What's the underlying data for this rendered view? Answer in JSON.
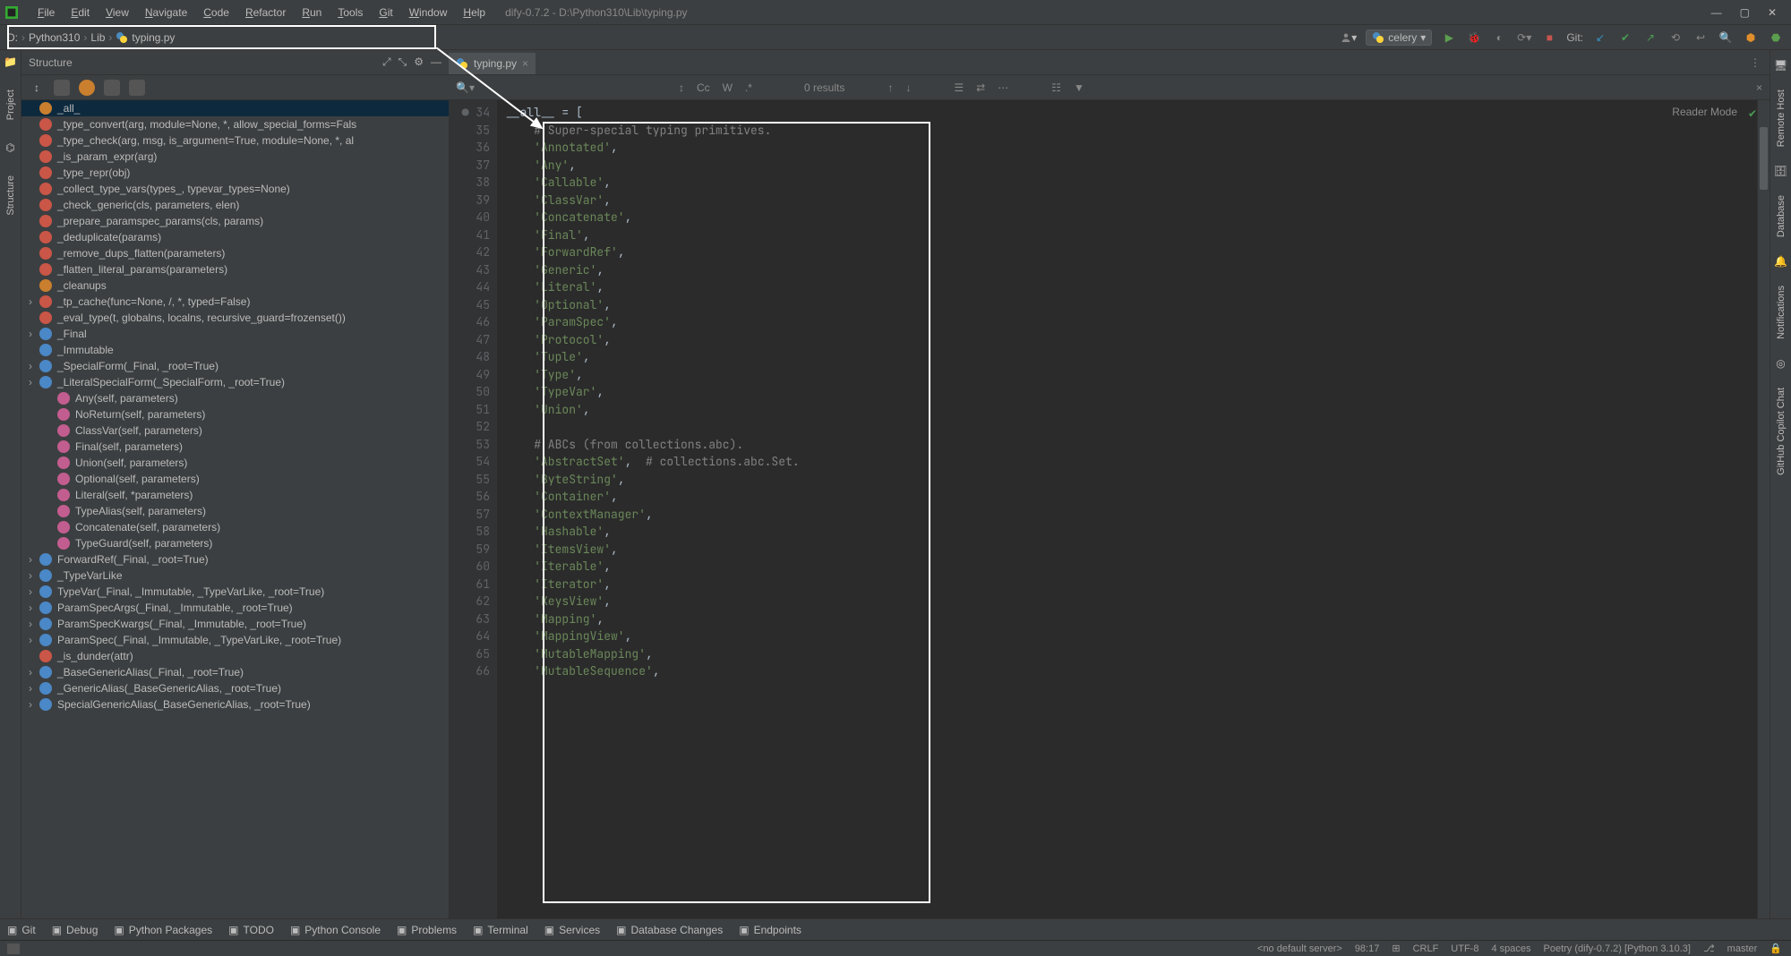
{
  "window": {
    "title": "dify-0.7.2 - D:\\Python310\\Lib\\typing.py"
  },
  "menu": [
    "File",
    "Edit",
    "View",
    "Navigate",
    "Code",
    "Refactor",
    "Run",
    "Tools",
    "Git",
    "Window",
    "Help"
  ],
  "breadcrumb": {
    "drive": "D:",
    "p1": "Python310",
    "p2": "Lib",
    "p3": "typing.py"
  },
  "runconfig": {
    "name": "celery"
  },
  "git_label": "Git:",
  "tab": {
    "name": "typing.py"
  },
  "find": {
    "results": "0 results",
    "cc": "Cc",
    "w": "W",
    "star": ".*"
  },
  "reader_mode": "Reader Mode",
  "sidebar": {
    "title": "Structure"
  },
  "rails": {
    "project": "Project",
    "structure": "Structure",
    "remote": "Remote Host",
    "database": "Database",
    "notifications": "Notifications",
    "copilot": "GitHub Copilot Chat"
  },
  "tree": [
    {
      "ic": "v",
      "chev": "",
      "t": "_all_",
      "sel": true
    },
    {
      "ic": "f",
      "t": "_type_convert(arg, module=None, *, allow_special_forms=Fals"
    },
    {
      "ic": "f",
      "t": "_type_check(arg, msg, is_argument=True, module=None, *, al"
    },
    {
      "ic": "f",
      "t": "_is_param_expr(arg)"
    },
    {
      "ic": "f",
      "t": "_type_repr(obj)"
    },
    {
      "ic": "f",
      "t": "_collect_type_vars(types_, typevar_types=None)"
    },
    {
      "ic": "f",
      "t": "_check_generic(cls, parameters, elen)"
    },
    {
      "ic": "f",
      "t": "_prepare_paramspec_params(cls, params)"
    },
    {
      "ic": "f",
      "t": "_deduplicate(params)"
    },
    {
      "ic": "f",
      "t": "_remove_dups_flatten(parameters)"
    },
    {
      "ic": "f",
      "t": "_flatten_literal_params(parameters)"
    },
    {
      "ic": "v",
      "t": "_cleanups"
    },
    {
      "ic": "f",
      "chev": "›",
      "t": "_tp_cache(func=None, /, *, typed=False)"
    },
    {
      "ic": "f",
      "t": "_eval_type(t, globalns, localns, recursive_guard=frozenset())"
    },
    {
      "ic": "c",
      "chev": "›",
      "t": "_Final"
    },
    {
      "ic": "c",
      "t": "_Immutable"
    },
    {
      "ic": "c",
      "chev": "›",
      "t": "_SpecialForm(_Final, _root=True)"
    },
    {
      "ic": "c",
      "chev": "›",
      "t": "_LiteralSpecialForm(_SpecialForm, _root=True)"
    },
    {
      "ic": "m",
      "indent": true,
      "t": "Any(self, parameters)"
    },
    {
      "ic": "m",
      "indent": true,
      "t": "NoReturn(self, parameters)"
    },
    {
      "ic": "m",
      "indent": true,
      "t": "ClassVar(self, parameters)"
    },
    {
      "ic": "m",
      "indent": true,
      "t": "Final(self, parameters)"
    },
    {
      "ic": "m",
      "indent": true,
      "t": "Union(self, parameters)"
    },
    {
      "ic": "m",
      "indent": true,
      "t": "Optional(self, parameters)"
    },
    {
      "ic": "m",
      "indent": true,
      "t": "Literal(self, *parameters)"
    },
    {
      "ic": "m",
      "indent": true,
      "t": "TypeAlias(self, parameters)"
    },
    {
      "ic": "m",
      "indent": true,
      "t": "Concatenate(self, parameters)"
    },
    {
      "ic": "m",
      "indent": true,
      "t": "TypeGuard(self, parameters)"
    },
    {
      "ic": "c",
      "chev": "›",
      "t": "ForwardRef(_Final, _root=True)"
    },
    {
      "ic": "c",
      "chev": "›",
      "t": "_TypeVarLike"
    },
    {
      "ic": "c",
      "chev": "›",
      "t": "TypeVar(_Final, _Immutable, _TypeVarLike, _root=True)"
    },
    {
      "ic": "c",
      "chev": "›",
      "t": "ParamSpecArgs(_Final, _Immutable, _root=True)"
    },
    {
      "ic": "c",
      "chev": "›",
      "t": "ParamSpecKwargs(_Final, _Immutable, _root=True)"
    },
    {
      "ic": "c",
      "chev": "›",
      "t": "ParamSpec(_Final, _Immutable, _TypeVarLike, _root=True)"
    },
    {
      "ic": "f",
      "t": "_is_dunder(attr)"
    },
    {
      "ic": "c",
      "chev": "›",
      "t": "_BaseGenericAlias(_Final, _root=True)"
    },
    {
      "ic": "c",
      "chev": "›",
      "t": "_GenericAlias(_BaseGenericAlias, _root=True)"
    },
    {
      "ic": "c",
      "chev": "›",
      "t": "SpecialGenericAlias(_BaseGenericAlias, _root=True)"
    }
  ],
  "lines": [
    {
      "n": 34,
      "html": "__all__ = ["
    },
    {
      "n": 35,
      "html": "    <span class='cm'># Super-special typing primitives.</span>"
    },
    {
      "n": 36,
      "html": "    <span class='s'>'Annotated'</span>,"
    },
    {
      "n": 37,
      "html": "    <span class='s'>'Any'</span>,"
    },
    {
      "n": 38,
      "html": "    <span class='s'>'Callable'</span>,"
    },
    {
      "n": 39,
      "html": "    <span class='s'>'ClassVar'</span>,"
    },
    {
      "n": 40,
      "html": "    <span class='s'>'Concatenate'</span>,"
    },
    {
      "n": 41,
      "html": "    <span class='s'>'Final'</span>,"
    },
    {
      "n": 42,
      "html": "    <span class='s'>'ForwardRef'</span>,"
    },
    {
      "n": 43,
      "html": "    <span class='s'>'Generic'</span>,"
    },
    {
      "n": 44,
      "html": "    <span class='s'>'Literal'</span>,"
    },
    {
      "n": 45,
      "html": "    <span class='s'>'Optional'</span>,"
    },
    {
      "n": 46,
      "html": "    <span class='s'>'ParamSpec'</span>,"
    },
    {
      "n": 47,
      "html": "    <span class='s'>'Protocol'</span>,"
    },
    {
      "n": 48,
      "html": "    <span class='s'>'Tuple'</span>,"
    },
    {
      "n": 49,
      "html": "    <span class='s'>'Type'</span>,"
    },
    {
      "n": 50,
      "html": "    <span class='s'>'TypeVar'</span>,"
    },
    {
      "n": 51,
      "html": "    <span class='s'>'Union'</span>,"
    },
    {
      "n": 52,
      "html": ""
    },
    {
      "n": 53,
      "html": "    <span class='cm'># ABCs (from collections.abc).</span>"
    },
    {
      "n": 54,
      "html": "    <span class='s'>'AbstractSet'</span>,  <span class='cm'># collections.abc.Set.</span>"
    },
    {
      "n": 55,
      "html": "    <span class='s'>'ByteString'</span>,"
    },
    {
      "n": 56,
      "html": "    <span class='s'>'Container'</span>,"
    },
    {
      "n": 57,
      "html": "    <span class='s'>'ContextManager'</span>,"
    },
    {
      "n": 58,
      "html": "    <span class='s'>'Hashable'</span>,"
    },
    {
      "n": 59,
      "html": "    <span class='s'>'ItemsView'</span>,"
    },
    {
      "n": 60,
      "html": "    <span class='s'>'Iterable'</span>,"
    },
    {
      "n": 61,
      "html": "    <span class='s'>'Iterator'</span>,"
    },
    {
      "n": 62,
      "html": "    <span class='s'>'KeysView'</span>,"
    },
    {
      "n": 63,
      "html": "    <span class='s'>'Mapping'</span>,"
    },
    {
      "n": 64,
      "html": "    <span class='s'>'MappingView'</span>,"
    },
    {
      "n": 65,
      "html": "    <span class='s'>'MutableMapping'</span>,"
    },
    {
      "n": 66,
      "html": "    <span class='s'>'MutableSequence'</span>,"
    }
  ],
  "bottom": [
    {
      "icon": "git",
      "t": "Git"
    },
    {
      "icon": "bug",
      "t": "Debug"
    },
    {
      "icon": "pkg",
      "t": "Python Packages"
    },
    {
      "icon": "todo",
      "t": "TODO"
    },
    {
      "icon": "py",
      "t": "Python Console"
    },
    {
      "icon": "warn",
      "t": "Problems"
    },
    {
      "icon": "term",
      "t": "Terminal"
    },
    {
      "icon": "svc",
      "t": "Services"
    },
    {
      "icon": "db",
      "t": "Database Changes"
    },
    {
      "icon": "ep",
      "t": "Endpoints"
    }
  ],
  "status": {
    "server": "<no default server>",
    "pos": "98:17",
    "le": "CRLF",
    "enc": "UTF-8",
    "indent": "4 spaces",
    "interp": "Poetry (dify-0.7.2) [Python 3.10.3]",
    "branch": "master"
  }
}
